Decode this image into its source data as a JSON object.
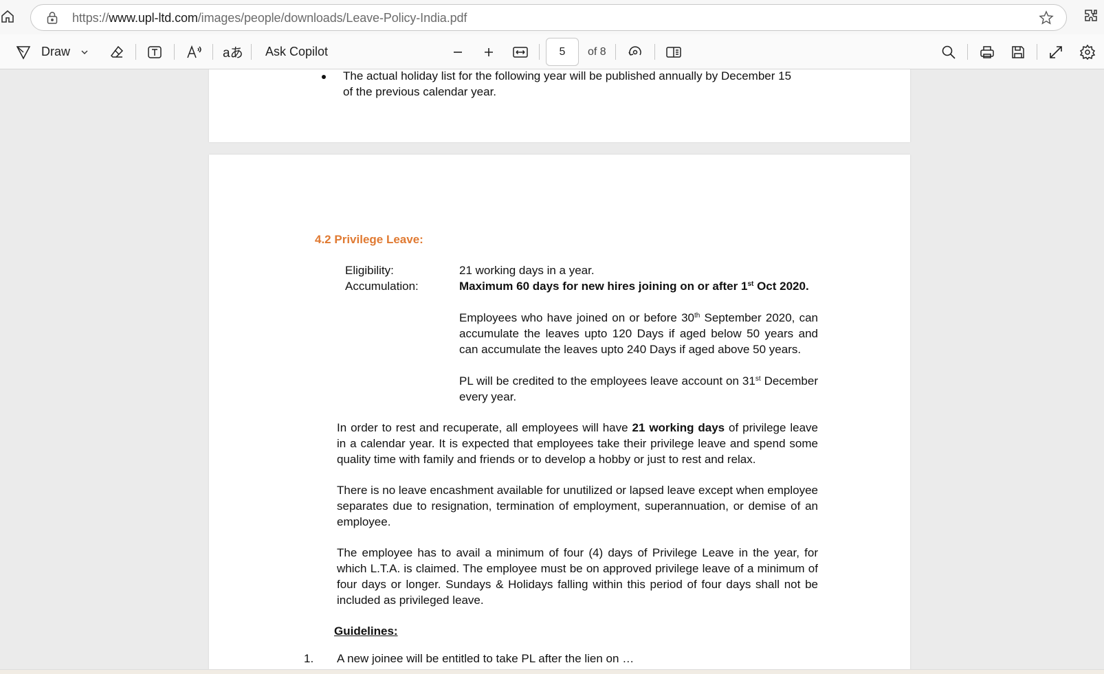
{
  "browser": {
    "url_prefix": "https://",
    "url_domain": "www.upl-ltd.com",
    "url_path": "/images/people/downloads/Leave-Policy-India.pdf"
  },
  "toolbar": {
    "draw_label": "Draw",
    "ask_copilot_label": "Ask Copilot",
    "page_number": "5",
    "page_total": "of 8"
  },
  "page_prev": {
    "bullet_line1": "The actual holiday list for the following year will be published annually by December 15",
    "bullet_line2": "of the previous calendar year."
  },
  "section": {
    "number": "4.2",
    "title": "Privilege Leave:",
    "eligibility_label": "Eligibility:",
    "eligibility_value": "21 working days in a year.",
    "accumulation_label": "Accumulation:",
    "accumulation_value_pre": "Maximum 60 days for new hires joining on or after 1",
    "accumulation_sup": "st",
    "accumulation_value_post": " Oct 2020.",
    "acc_p1_pre": "Employees who have joined on or before 30",
    "acc_p1_sup": "th",
    "acc_p1_post": " September 2020, can accumulate the leaves upto 120 Days if aged below 50 years and can accumulate the leaves upto 240 Days if aged above 50 years.",
    "acc_p2_pre": "PL will be credited to the employees leave account on 31",
    "acc_p2_sup": "st",
    "acc_p2_post": " December every year.",
    "para1_pre": "In order to rest and recuperate, all employees will have ",
    "para1_bold": "21 working days",
    "para1_post": " of privilege leave in a calendar year. It is expected that employees take their privilege leave and spend some quality time with family and friends or to develop a hobby or just to rest and relax.",
    "para2": "There is no leave encashment available for unutilized or lapsed leave except when employee separates due to resignation, termination of employment, superannuation, or demise of an employee.",
    "para3": "The employee has to avail a minimum of four (4) days of Privilege Leave in the year, for which L.T.A. is claimed. The employee must be on approved privilege leave of a minimum of four days or longer. Sundays & Holidays falling within this period of four days shall not be included as privileged leave.",
    "guidelines": "Guidelines:",
    "next_item_number": "1.",
    "next_item_text": "A new joinee will be entitled to take PL after the lien on …"
  }
}
